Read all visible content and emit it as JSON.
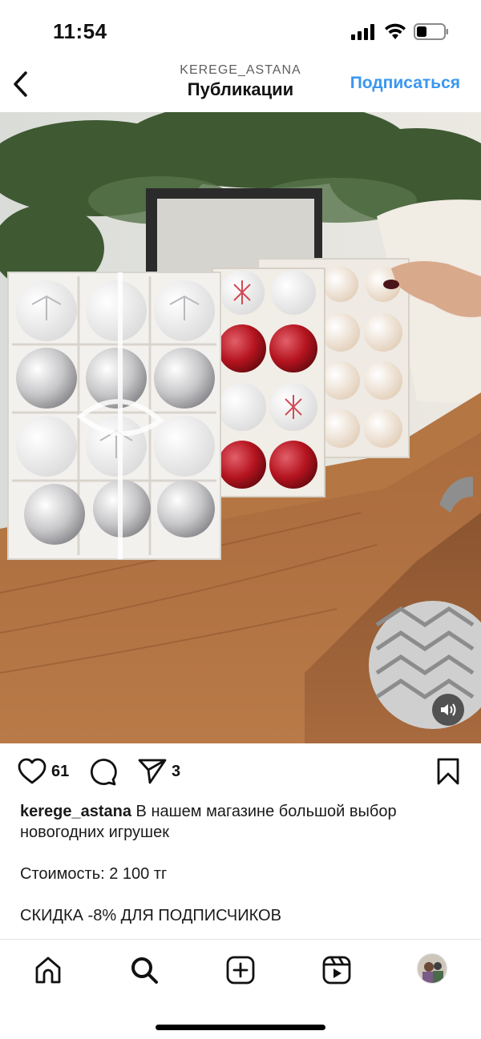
{
  "status_bar": {
    "time": "11:54"
  },
  "header": {
    "username": "KEREGE_ASTANA",
    "title": "Публикации",
    "subscribe_label": "Подписаться"
  },
  "actions": {
    "likes": "61",
    "shares": "3"
  },
  "caption": {
    "username": "kerege_astana",
    "text": "В нашем магазине большой выбор новогодних  игрушек",
    "price": "Стоимость: 2 100 тг",
    "discount": "СКИДКА -8% ДЛЯ ПОДПИСЧИКОВ"
  },
  "icons": {
    "back": "chevron-left-icon",
    "like": "heart-icon",
    "comment": "comment-icon",
    "share": "send-icon",
    "save": "bookmark-icon",
    "sound": "speaker-icon",
    "home": "home-icon",
    "search": "search-icon",
    "create": "plus-square-icon",
    "reels": "reels-icon"
  },
  "colors": {
    "accent": "#3897f0"
  }
}
